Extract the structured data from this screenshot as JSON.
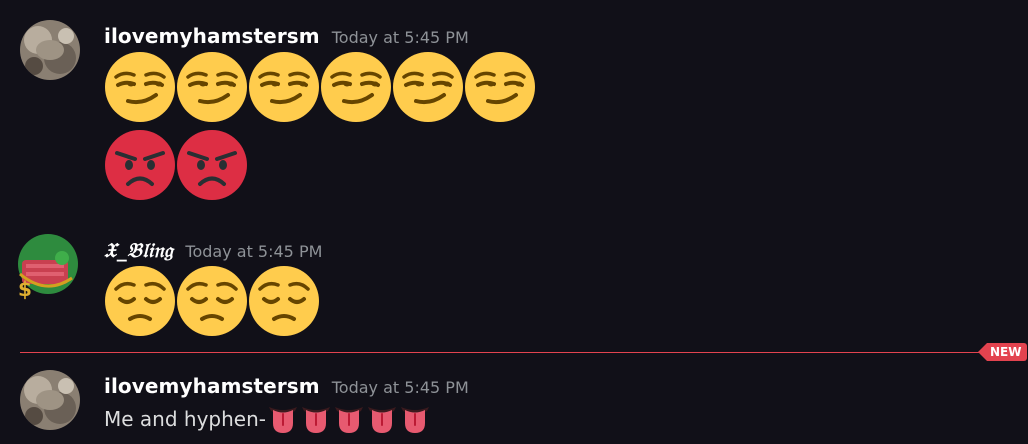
{
  "messages": [
    {
      "username": "ilovemyhamstersm",
      "timestamp": "Today at 5:45 PM",
      "emoji_rows": [
        [
          "smirking-face-emoji",
          "smirking-face-emoji",
          "smirking-face-emoji",
          "smirking-face-emoji",
          "smirking-face-emoji",
          "smirking-face-emoji"
        ],
        [
          "pouting-face-emoji",
          "pouting-face-emoji"
        ]
      ]
    },
    {
      "username": "𝔛_𝔅𝔩𝔦𝔫𝔤",
      "timestamp": "Today at 5:45 PM",
      "emoji_rows": [
        [
          "pensive-face-emoji",
          "pensive-face-emoji",
          "pensive-face-emoji"
        ]
      ]
    },
    {
      "username": "ilovemyhamstersm",
      "timestamp": "Today at 5:45 PM",
      "text": "Me and hyphen-",
      "inline_emoji": [
        "tongue-emoji",
        "tongue-emoji",
        "tongue-emoji",
        "tongue-emoji",
        "tongue-emoji"
      ]
    }
  ],
  "divider": {
    "label": "NEW",
    "color": "#e3434f"
  },
  "colors": {
    "background": "#111018",
    "username": "#ffffff",
    "timestamp": "#8e9297",
    "emoji_yellow": "#ffcc4d",
    "emoji_red": "#dd2e44"
  }
}
